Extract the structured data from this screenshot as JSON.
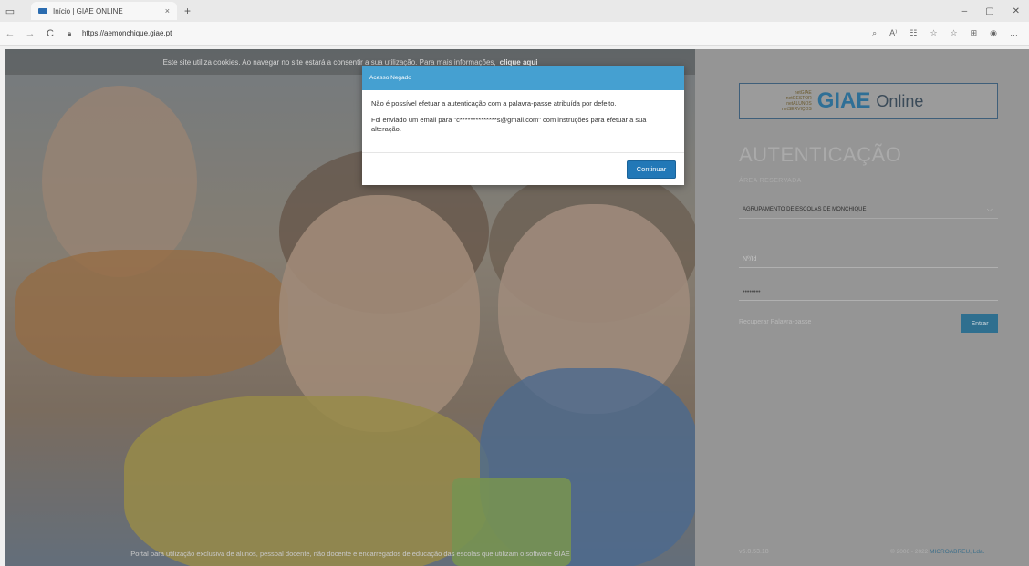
{
  "browser": {
    "tab_title": "Início | GIAE ONLINE",
    "tab_close": "×",
    "new_tab": "+",
    "url": "https://aemonchique.giae.pt",
    "window_controls": [
      "–",
      "▢",
      "✕"
    ],
    "nav": {
      "back": "←",
      "forward": "→",
      "reload": "C"
    },
    "toolbar_icons": [
      "⌕",
      "A⁾",
      "☷",
      "☆",
      "☆",
      "⊞",
      "◉",
      "…"
    ]
  },
  "cookie_bar": {
    "text": "Este site utiliza cookies. Ao navegar no site estará a consentir a sua utilização. Para mais informações,",
    "link": "clique aqui"
  },
  "footer_text": "Portal para utilização exclusiva de alunos, pessoal docente, não docente e encarregados de educação das escolas que utilizam o software GIAE",
  "login": {
    "logo_small_lines": [
      "netGIAE",
      "netGESTOR",
      "netALUNOS",
      "netSERVIÇOS"
    ],
    "logo_main": "GIAE",
    "logo_sub": "Online",
    "title": "AUTENTICAÇÃO",
    "subtitle": "ÁREA RESERVADA",
    "school": "AGRUPAMENTO DE ESCOLAS DE MONCHIQUE",
    "user_placeholder": "Nº/Id",
    "password_value": "••••••••",
    "recover": "Recuperar Palavra-passe",
    "enter_button": "Entrar",
    "version": "v5.0.53.18",
    "copyright_prefix": "© 2006 - 2022 ",
    "copyright_company": "MICROABREU, Lda."
  },
  "modal": {
    "title": "Acesso Negado",
    "line1": "Não é possível efetuar a autenticação com a palavra-passe atribuída por defeito.",
    "line2": "Foi enviado um email para \"c**************s@gmail.com\" com instruções para efetuar a sua alteração.",
    "button": "Continuar"
  }
}
